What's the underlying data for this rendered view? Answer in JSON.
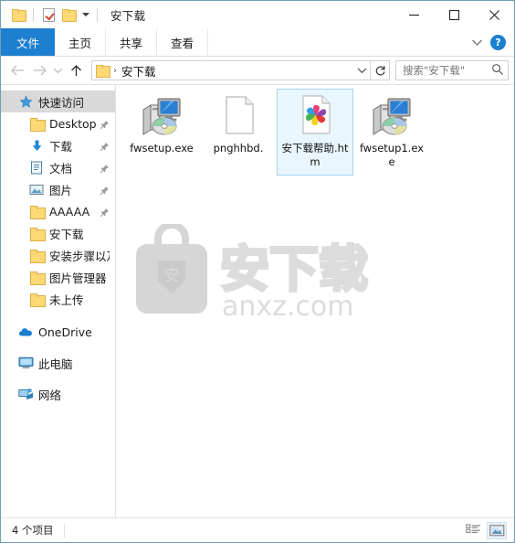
{
  "window": {
    "title": "安下载",
    "quick_access_toolbar": [
      {
        "name": "folder-properties-icon",
        "label": "属性"
      },
      {
        "name": "checkmark-properties-icon",
        "label": "属性"
      },
      {
        "name": "new-folder-icon",
        "label": "新建文件夹"
      },
      {
        "name": "customize-caret-icon",
        "label": "自定义快速访问工具栏"
      }
    ],
    "controls": {
      "minimize": "最小化",
      "maximize": "最大化",
      "close": "关闭"
    }
  },
  "ribbon": {
    "tabs": [
      {
        "label": "文件",
        "active": true
      },
      {
        "label": "主页",
        "active": false
      },
      {
        "label": "共享",
        "active": false
      },
      {
        "label": "查看",
        "active": false
      }
    ],
    "expand_label": "展开功能区",
    "help_label": "?"
  },
  "address_bar": {
    "back_label": "后退",
    "forward_label": "前进",
    "recent_label": "最近使用的位置",
    "up_label": "上移到",
    "breadcrumb": {
      "separator": "›",
      "path": "安下载"
    },
    "refresh_label": "刷新",
    "dropdown_label": "以前的位置"
  },
  "search": {
    "placeholder": "搜索\"安下载\""
  },
  "sidebar": {
    "items": [
      {
        "label": "快速访问",
        "icon": "star-icon",
        "level": 0,
        "selected": true,
        "pinned": false
      },
      {
        "label": "Desktop",
        "icon": "folder-icon",
        "level": 1,
        "selected": false,
        "pinned": true
      },
      {
        "label": "下载",
        "icon": "download-icon",
        "level": 1,
        "selected": false,
        "pinned": true
      },
      {
        "label": "文档",
        "icon": "document-icon",
        "level": 1,
        "selected": false,
        "pinned": true
      },
      {
        "label": "图片",
        "icon": "pictures-icon",
        "level": 1,
        "selected": false,
        "pinned": true
      },
      {
        "label": "AAAAA",
        "icon": "folder-icon",
        "level": 1,
        "selected": false,
        "pinned": true
      },
      {
        "label": "安下载",
        "icon": "folder-icon",
        "level": 1,
        "selected": false,
        "pinned": false
      },
      {
        "label": "安装步骤以及",
        "icon": "folder-icon",
        "level": 1,
        "selected": false,
        "pinned": false
      },
      {
        "label": "图片管理器",
        "icon": "folder-icon",
        "level": 1,
        "selected": false,
        "pinned": false
      },
      {
        "label": "未上传",
        "icon": "folder-icon",
        "level": 1,
        "selected": false,
        "pinned": false
      },
      {
        "label": "OneDrive",
        "icon": "cloud-icon",
        "level": 0,
        "selected": false,
        "pinned": false
      },
      {
        "label": "此电脑",
        "icon": "computer-icon",
        "level": 0,
        "selected": false,
        "pinned": false
      },
      {
        "label": "网络",
        "icon": "network-icon",
        "level": 0,
        "selected": false,
        "pinned": false
      }
    ]
  },
  "files": {
    "items": [
      {
        "name": "fwsetup.exe",
        "icon": "setup-exe-icon",
        "selected": false
      },
      {
        "name": "pnghhbd.",
        "icon": "blank-page-icon",
        "selected": false
      },
      {
        "name": "安下载帮助.htm",
        "icon": "html-chrome-icon",
        "selected": true
      },
      {
        "name": "fwsetup1.exe",
        "icon": "setup-exe-icon",
        "selected": false
      }
    ]
  },
  "watermark": {
    "brand": "安下载",
    "shield_char": "安",
    "domain": "anxz.com"
  },
  "status_bar": {
    "item_count": "4 个项目",
    "views": [
      {
        "name": "details-view-icon",
        "label": "详细信息",
        "active": false
      },
      {
        "name": "large-icons-view-icon",
        "label": "大图标",
        "active": true
      }
    ]
  },
  "colors": {
    "accent": "#1d7fd0",
    "selection_bg": "#eaf6fd",
    "selection_border": "#a3d4ef",
    "folder_yellow": "#fcd975",
    "window_border": "#6ea0b5"
  }
}
